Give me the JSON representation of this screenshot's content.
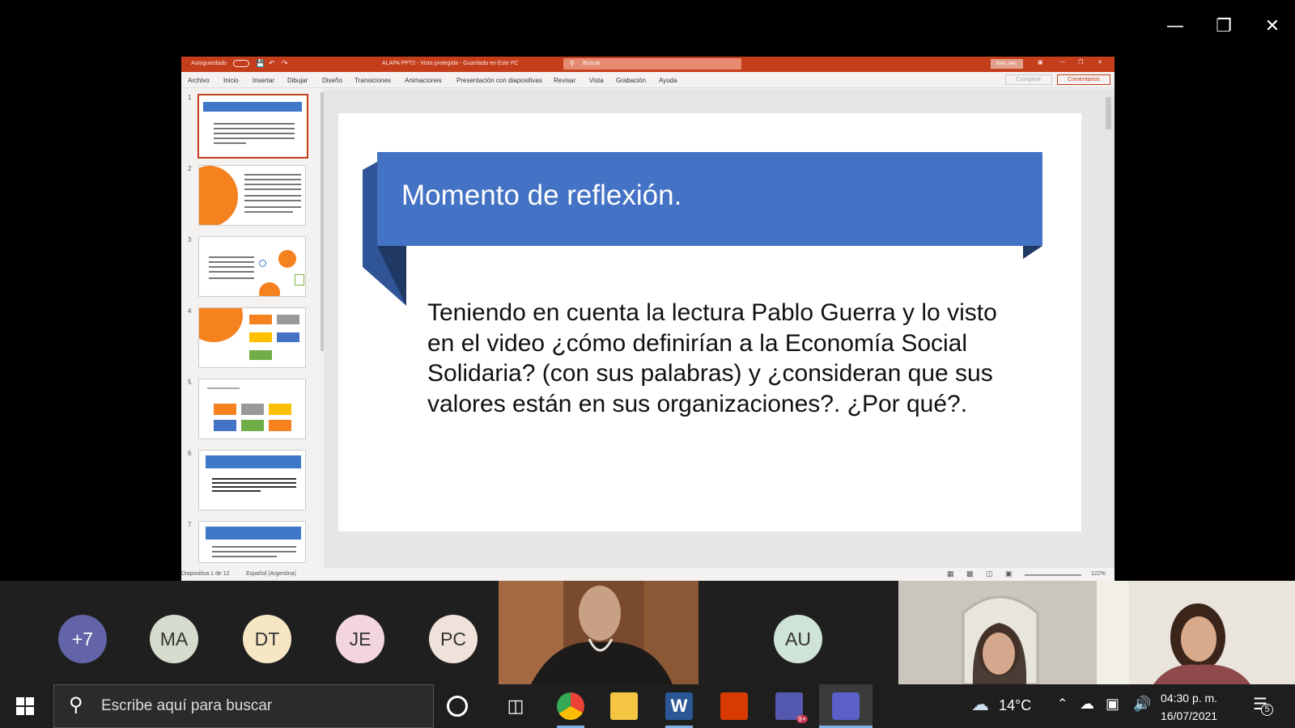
{
  "ppt": {
    "autosave": "Autoguardado",
    "doc_title": "ALAPA PPT2 - Vista protegida - Guardado en Este PC",
    "search_placeholder": "Buscar",
    "user_badge": "Ines, ses.",
    "menu": [
      "Archivo",
      "Inicio",
      "Insertar",
      "Dibujar",
      "Diseño",
      "Transiciones",
      "Animaciones",
      "Presentación con diapositivas",
      "Revisar",
      "Vista",
      "Grabación",
      "Ayuda"
    ],
    "share": "Compartir",
    "comments": "Comentarios",
    "thumb_numbers": [
      "1",
      "2",
      "3",
      "4",
      "5",
      "6",
      "7"
    ],
    "slide_title": "Momento de reflexión.",
    "slide_body": "Teniendo en cuenta la lectura Pablo Guerra y lo visto en el video ¿cómo definirían a la Economía Social Solidaria? (con sus palabras) y ¿consideran que sus valores están en sus organizaciones?. ¿Por qué?.",
    "status_slide": "Diapositiva 1 de 12",
    "status_lang": "Español (Argentina)",
    "zoom": "122%"
  },
  "participants": {
    "avatars": [
      {
        "initials": "+7",
        "bg": "#6264a7",
        "fg": "#ffffff"
      },
      {
        "initials": "MA",
        "bg": "#d6dccd",
        "fg": "#333333"
      },
      {
        "initials": "DT",
        "bg": "#f6e6c4",
        "fg": "#333333"
      },
      {
        "initials": "JE",
        "bg": "#f3d6dd",
        "fg": "#333333"
      },
      {
        "initials": "PC",
        "bg": "#efe2da",
        "fg": "#333333"
      },
      {
        "initials": "AU",
        "bg": "#cfe3d6",
        "fg": "#333333"
      }
    ]
  },
  "taskbar": {
    "search_placeholder": "Escribe aquí para buscar",
    "weather": "14°C",
    "time": "04:30 p. m.",
    "date": "16/07/2021",
    "notifications": "5",
    "teams_badge": "9+"
  },
  "colors": {
    "ppt_red": "#c43e1c",
    "banner_blue": "#4472c4",
    "accent_orange": "#f5821f"
  }
}
